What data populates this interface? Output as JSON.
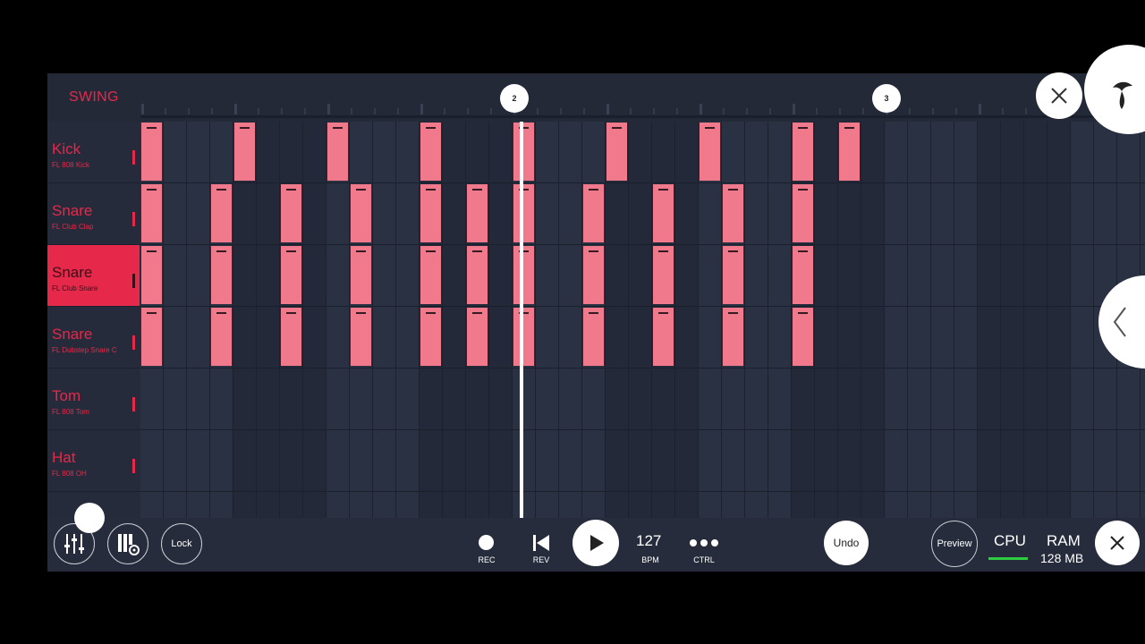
{
  "header": {
    "swing_label": "SWING"
  },
  "ruler": {
    "markers": [
      "2",
      "3"
    ]
  },
  "channels": [
    {
      "name": "Kick",
      "sample": "FL 808 Kick",
      "selected": false
    },
    {
      "name": "Snare",
      "sample": "FL Club Clap",
      "selected": false
    },
    {
      "name": "Snare",
      "sample": "FL Club Snare",
      "selected": true
    },
    {
      "name": "Snare",
      "sample": "FL Dubstep Snare C",
      "selected": false
    },
    {
      "name": "Tom",
      "sample": "FL 808 Tom",
      "selected": false
    },
    {
      "name": "Hat",
      "sample": "FL 808 OH",
      "selected": false
    }
  ],
  "pattern": {
    "steps_per_row": 40,
    "active_steps": [
      [
        0,
        4,
        8,
        12,
        16,
        20,
        24,
        28,
        30
      ],
      [
        0,
        3,
        6,
        9,
        12,
        14,
        16,
        19,
        22,
        25,
        28
      ],
      [
        0,
        3,
        6,
        9,
        12,
        14,
        16,
        19,
        22,
        25,
        28
      ],
      [
        0,
        3,
        6,
        9,
        12,
        14,
        16,
        19,
        22,
        25,
        28
      ],
      [],
      []
    ],
    "playhead_step": 16.3
  },
  "transport": {
    "lock_label": "Lock",
    "rec_label": "REC",
    "rev_label": "REV",
    "bpm_value": "127",
    "bpm_label": "BPM",
    "ctrl_label": "CTRL",
    "undo_label": "Undo",
    "preview_label": "Preview",
    "cpu_label": "CPU",
    "ram_label": "RAM",
    "ram_value": "128 MB"
  },
  "colors": {
    "accent": "#e6284a",
    "step_on": "#f07a8c",
    "background": "#252b3a"
  },
  "icons": {
    "mixer": "mixer-icon",
    "piano_roll": "piano-settings-icon",
    "rec": "record-icon",
    "rev": "skip-back-icon",
    "play": "play-icon",
    "ctrl": "more-dots-icon",
    "close": "close-icon",
    "back": "chevron-left-icon",
    "logo": "fruit-logo-icon"
  }
}
